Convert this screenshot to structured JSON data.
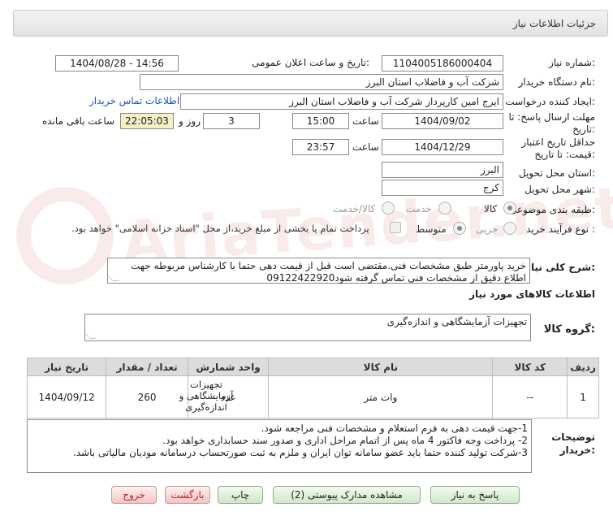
{
  "header": {
    "title": "جزئیات اطلاعات نیاز"
  },
  "watermark": {
    "text": "AriaTender.net"
  },
  "fields": {
    "need_number_label": "شماره نیاز:",
    "need_number": "1104005186000404",
    "announce_label": "تاریخ و ساعت اعلان عمومی:",
    "announce_value": "1404/08/28 - 14:56",
    "buyer_org_label": "نام دستگاه خریدار:",
    "buyer_org": "شرکت آب و فاضلاب استان البرز",
    "requester_label": "ایجاد کننده درخواست:",
    "requester": "ایرج امین کارپرداز شرکت آب و فاضلاب استان البرز",
    "contact_link": "اطلاعات تماس خریدار",
    "deadline_label_1": "مهلت ارسال پاسخ: تا",
    "deadline_label_2": "تاریخ:",
    "deadline_date": "1404/09/02",
    "time_label": "ساعت",
    "deadline_time": "15:00",
    "days_value": "3",
    "days_label": "روز و",
    "remaining_time": "22:05:03",
    "remaining_label": "ساعت باقی مانده",
    "validity_label_1": "حداقل تاریخ اعتبار",
    "validity_label_2": "قیمت: تا تاریخ:",
    "validity_date": "1404/12/29",
    "validity_time_label": "ساعت",
    "validity_time": "23:57",
    "province_label": "استان محل تحویل:",
    "province": "البرز",
    "city_label": "شهر محل تحویل:",
    "city": "کرج",
    "category_label": "طبقه بندی موضوعی:",
    "category_options": [
      "کالا",
      "خدمت",
      "کالا/خدمت"
    ],
    "process_label": "نوع فرآیند خرید :",
    "process_options": [
      "جزیی",
      "متوسط"
    ],
    "payment_note": "پرداخت تمام یا بخشی از مبلغ خرید،از محل \"اسناد خزانه اسلامی\" خواهد بود."
  },
  "description": {
    "label": "شرح کلی نیاز:",
    "text": "خرید پاورمتر طبق مشخصات فنی.مقتضی است قبل از قیمت دهی حتما با کارشناس مربوطه جهت اطلاع دقیق از مشخصات فنی تماس گرفته شود09122422920"
  },
  "goods_info": {
    "title": "اطلاعات کالاهای مورد نیاز",
    "group_label": "گروه کالا:",
    "group_value": "تجهیزات آزمایشگاهی و اندازه‌گیری"
  },
  "table": {
    "headers": [
      "ردیف",
      "کد کالا",
      "نام کالا",
      "واحد شمارش",
      "تعداد / مقدار",
      "تاریخ نیاز"
    ],
    "rows": [
      [
        "1",
        "--",
        "وات متر",
        "عدد",
        "260",
        "1404/09/12"
      ]
    ],
    "row_group": "تجهیزات آزمایشگاهی و اندازه‌گیری"
  },
  "buyer_notes": {
    "label_1": "توضیحات",
    "label_2": "خریدار:",
    "lines": [
      "1-جهت قیمت دهی به فرم استعلام و مشخصات فنی مراجعه شود.",
      "2- پرداخت وجه فاکتور 4 ماه پس از اتمام مراحل اداری و صدور سند حسابداری خواهد بود.",
      "3-شرکت تولید کننده حتما باید عضو سامانه توان ایران و ملزم به ثبت صورتحساب درسامانه مودیان مالیاتی باشد."
    ]
  },
  "buttons": {
    "reply": "پاسخ به نیاز",
    "attachments": "مشاهده مدارک پیوستی (2)",
    "print": "چاپ",
    "back": "بازگشت",
    "exit": "خروج"
  }
}
